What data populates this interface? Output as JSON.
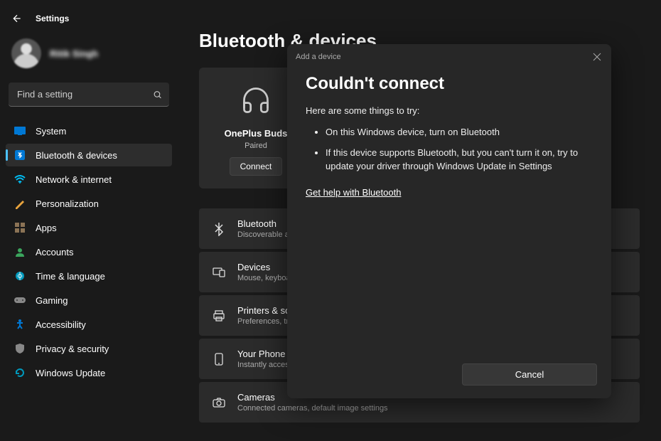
{
  "app_title": "Settings",
  "user": {
    "name": "Ritik Singh"
  },
  "search": {
    "placeholder": "Find a setting"
  },
  "sidebar": {
    "items": [
      {
        "label": "System",
        "icon": "system"
      },
      {
        "label": "Bluetooth & devices",
        "icon": "bluetooth",
        "active": true
      },
      {
        "label": "Network & internet",
        "icon": "network"
      },
      {
        "label": "Personalization",
        "icon": "personalization"
      },
      {
        "label": "Apps",
        "icon": "apps"
      },
      {
        "label": "Accounts",
        "icon": "accounts"
      },
      {
        "label": "Time & language",
        "icon": "time"
      },
      {
        "label": "Gaming",
        "icon": "gaming"
      },
      {
        "label": "Accessibility",
        "icon": "accessibility"
      },
      {
        "label": "Privacy & security",
        "icon": "privacy"
      },
      {
        "label": "Windows Update",
        "icon": "update"
      }
    ]
  },
  "page": {
    "title": "Bluetooth & devices",
    "device": {
      "name": "OnePlus Buds",
      "status": "Paired",
      "connect_label": "Connect"
    },
    "rows": [
      {
        "title": "Bluetooth",
        "sub": "Discoverable as \"VIV"
      },
      {
        "title": "Devices",
        "sub": "Mouse, keyboard, pe"
      },
      {
        "title": "Printers & scanne",
        "sub": "Preferences, troubles"
      },
      {
        "title": "Your Phone",
        "sub": "Instantly access you"
      },
      {
        "title": "Cameras",
        "sub": "Connected cameras, default image settings"
      }
    ]
  },
  "dialog": {
    "header_title": "Add a device",
    "title": "Couldn't connect",
    "intro": "Here are some things to try:",
    "bullets": [
      "On this Windows device, turn on Bluetooth",
      "If this device supports Bluetooth, but you can't turn it on, try to update your driver through Windows Update in Settings"
    ],
    "help_link": "Get help with Bluetooth",
    "cancel_label": "Cancel"
  }
}
